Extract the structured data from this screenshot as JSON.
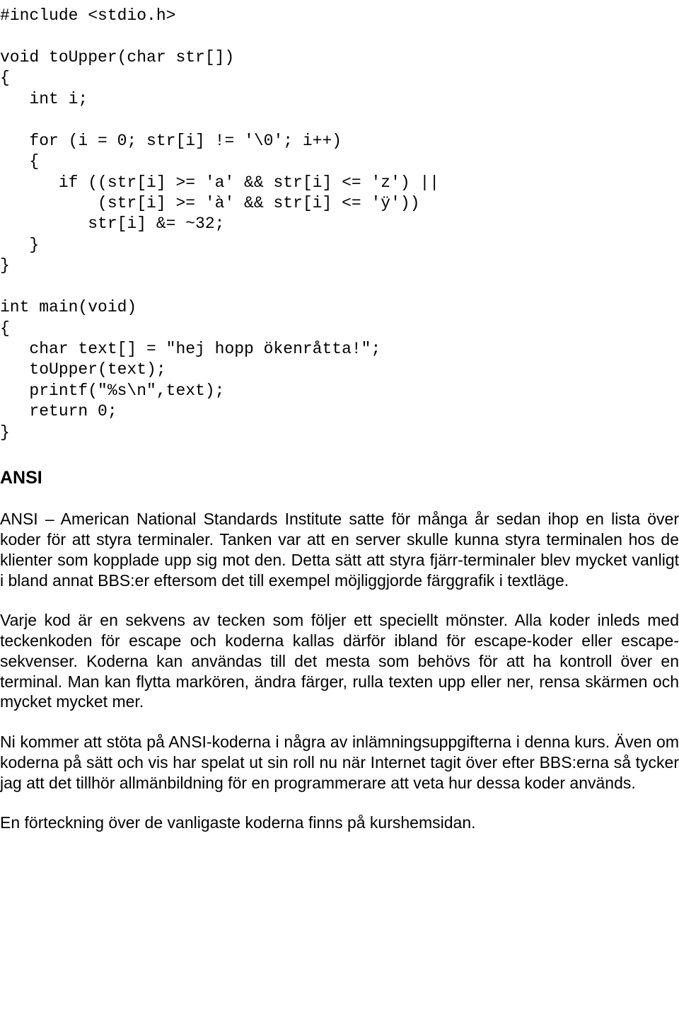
{
  "code": {
    "line1": "#include <stdio.h>",
    "line2": "",
    "line3": "void toUpper(char str[])",
    "line4": "{",
    "line5": "   int i;",
    "line6": "",
    "line7": "   for (i = 0; str[i] != '\\0'; i++)",
    "line8": "   {",
    "line9": "      if ((str[i] >= 'a' && str[i] <= 'z') ||",
    "line10": "          (str[i] >= 'à' && str[i] <= 'ÿ'))",
    "line11": "         str[i] &= ~32;",
    "line12": "   }",
    "line13": "}",
    "line14": "",
    "line15": "int main(void)",
    "line16": "{",
    "line17": "   char text[] = \"hej hopp ökenråtta!\";",
    "line18": "   toUpper(text);",
    "line19": "   printf(\"%s\\n\",text);",
    "line20": "   return 0;",
    "line21": "}"
  },
  "heading": "ANSI",
  "paragraphs": {
    "p1": "ANSI – American National Standards Institute satte för många år sedan ihop en lista över koder för att styra terminaler. Tanken var att en server skulle kunna styra terminalen hos de klienter som kopplade upp sig mot den. Detta sätt att styra fjärr-terminaler blev mycket vanligt i bland annat BBS:er eftersom det till exempel möjliggjorde färggrafik i textläge.",
    "p2": "Varje kod är en sekvens av tecken som följer ett speciellt mönster. Alla koder inleds med teckenkoden för escape och koderna kallas därför ibland för escape-koder eller escape-sekvenser. Koderna kan användas till det mesta som behövs för att ha kontroll över en terminal. Man kan flytta markören, ändra färger, rulla texten upp eller ner, rensa skärmen och mycket mycket mer.",
    "p3": "Ni kommer att stöta på ANSI-koderna i några av inlämningsuppgifterna i denna kurs. Även om koderna på sätt och vis har spelat ut sin roll nu när Internet tagit över efter BBS:erna så tycker jag att det tillhör allmänbildning för en programmerare att veta hur dessa koder används.",
    "p4": "En förteckning över de vanligaste koderna finns på kurshemsidan."
  }
}
